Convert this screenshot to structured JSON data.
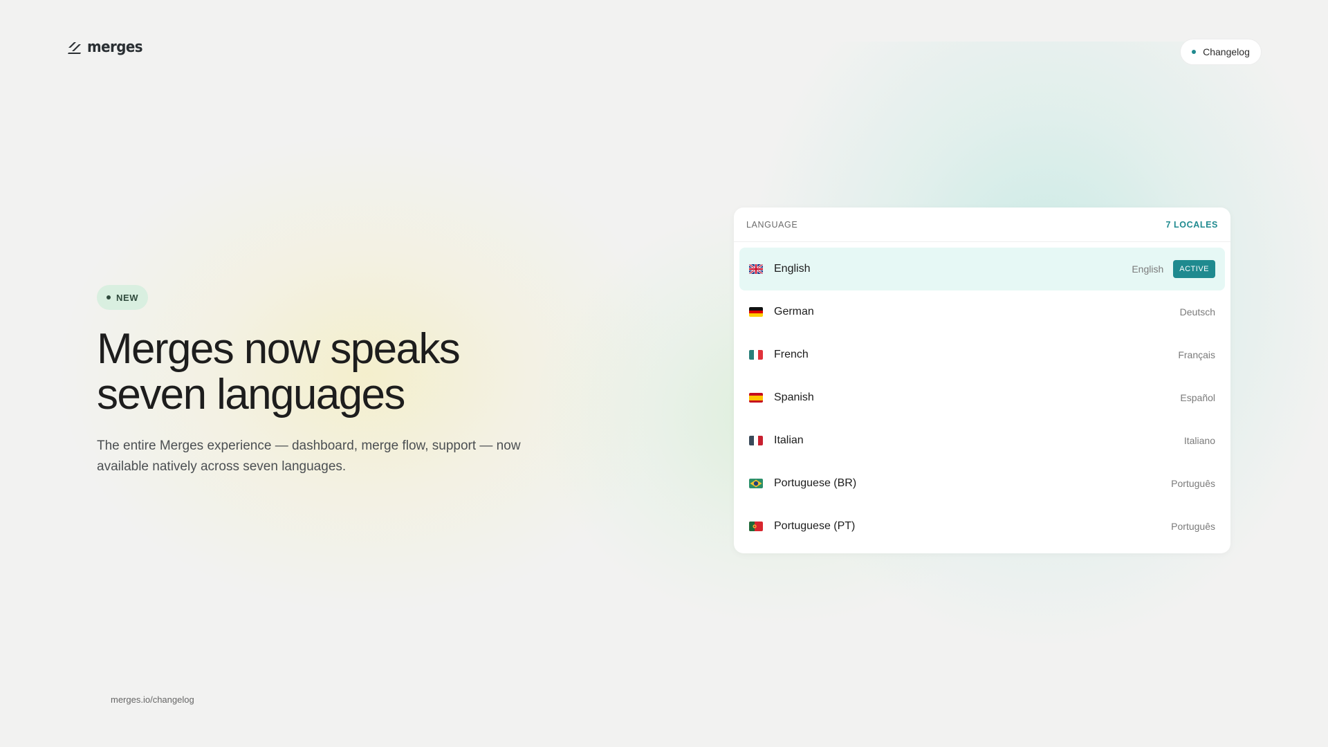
{
  "brand": {
    "name": "merges"
  },
  "nav": {
    "changelog_label": "Changelog"
  },
  "hero": {
    "badge": "NEW",
    "headline": "Merges now speaks seven languages",
    "subhead": "The entire Merges experience — dashboard, merge flow, support — now available natively across seven languages."
  },
  "footer": {
    "url": "merges.io/changelog"
  },
  "language_card": {
    "title": "LANGUAGE",
    "count": "7 LOCALES",
    "active_label": "ACTIVE",
    "items": [
      {
        "name": "English",
        "native": "English",
        "flag": "uk-flag-icon"
      },
      {
        "name": "German",
        "native": "Deutsch",
        "flag": "germany-flag-icon"
      },
      {
        "name": "French",
        "native": "Français",
        "flag": "france-flag-icon"
      },
      {
        "name": "Spanish",
        "native": "Español",
        "flag": "spain-flag-icon"
      },
      {
        "name": "Italian",
        "native": "Italiano",
        "flag": "italy-flag-icon"
      },
      {
        "name": "Portuguese (BR)",
        "native": "Português",
        "flag": "brazil-flag-icon"
      },
      {
        "name": "Portuguese (PT)",
        "native": "Português",
        "flag": "portugal-flag-icon"
      }
    ]
  },
  "colors": {
    "accent": "#1f8a8f",
    "active_row": "#e6f8f5",
    "badge_bg": "#d9efe0"
  }
}
